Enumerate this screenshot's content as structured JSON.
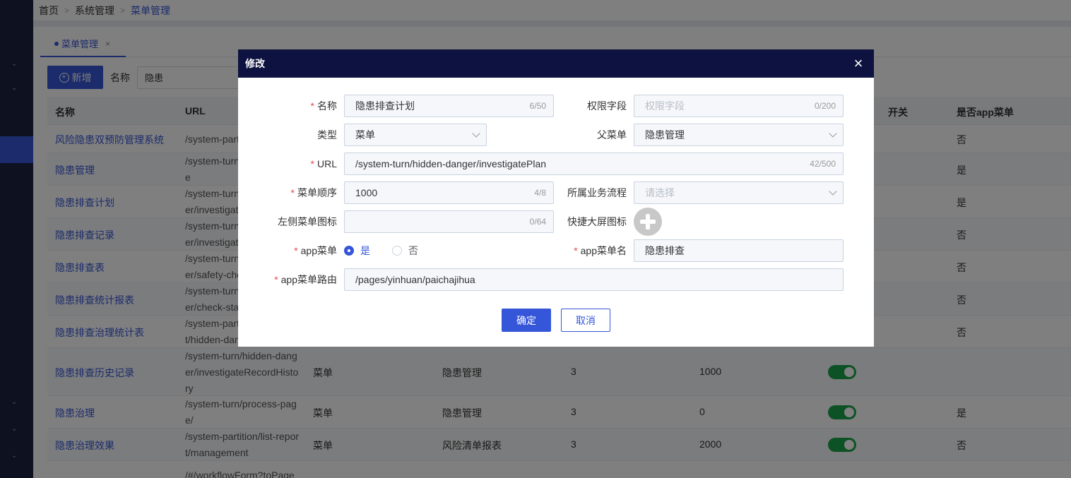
{
  "breadcrumb": {
    "home": "首页",
    "sep": ">",
    "system": "系统管理",
    "current": "菜单管理"
  },
  "tab": {
    "label": "菜单管理",
    "close": "×"
  },
  "toolbar": {
    "add_label": "新增",
    "add_icon": "+",
    "search_label": "名称",
    "search_value": "隐患"
  },
  "table": {
    "headers": {
      "name": "名称",
      "url": "URL",
      "switch": "开关",
      "app": "是否app菜单"
    },
    "rows": [
      {
        "name": "风险隐患双预防管理系统",
        "url": "/system-part",
        "type": "",
        "parent": "",
        "level": "",
        "order": "",
        "app": "否"
      },
      {
        "name": "隐患管理",
        "url": "/system-turn\ne",
        "type": "",
        "parent": "",
        "level": "",
        "order": "",
        "app": "是"
      },
      {
        "name": "隐患排查计划",
        "url": "/system-turn\ner/investigat",
        "type": "",
        "parent": "",
        "level": "",
        "order": "",
        "app": "是"
      },
      {
        "name": "隐患排查记录",
        "url": "/system-turn\ner/investigat",
        "type": "",
        "parent": "",
        "level": "",
        "order": "",
        "app": "否"
      },
      {
        "name": "隐患排查表",
        "url": "/system-turn\ner/safety-che",
        "type": "",
        "parent": "",
        "level": "",
        "order": "",
        "app": "否"
      },
      {
        "name": "隐患排查统计报表",
        "url": "/system-turn\ner/check-sta",
        "type": "",
        "parent": "",
        "level": "",
        "order": "",
        "app": "否"
      },
      {
        "name": "隐患排查治理统计表",
        "url": "/system-part\nt/hidden-dan",
        "type": "",
        "parent": "",
        "level": "",
        "order": "",
        "app": "否"
      },
      {
        "name": "隐患排查历史记录",
        "url": "/system-turn/hidden-dang\ner/investigateRecordHisto\nry",
        "type": "菜单",
        "parent": "隐患管理",
        "level": "3",
        "order": "1000",
        "app": ""
      },
      {
        "name": "隐患治理",
        "url": "/system-turn/process-pag\ne/",
        "type": "菜单",
        "parent": "隐患管理",
        "level": "3",
        "order": "0",
        "app": "是"
      },
      {
        "name": "隐患治理效果",
        "url": "/system-partition/list-repor\nt/management",
        "type": "菜单",
        "parent": "风险清单报表",
        "level": "3",
        "order": "2000",
        "app": "否"
      },
      {
        "name": "",
        "url": "/#/workflowForm?toPage",
        "type": "",
        "parent": "",
        "level": "",
        "order": "",
        "app": ""
      }
    ]
  },
  "dialog": {
    "title": "修改",
    "close": "×",
    "required_mark": "*",
    "name": {
      "label": "名称",
      "value": "隐患排查计划",
      "count": "6/50"
    },
    "perm": {
      "label": "权限字段",
      "placeholder": "权限字段",
      "count": "0/200"
    },
    "type": {
      "label": "类型",
      "value": "菜单"
    },
    "parent": {
      "label": "父菜单",
      "value": "隐患管理"
    },
    "url": {
      "label": "URL",
      "value": "/system-turn/hidden-danger/investigatePlan",
      "count": "42/500"
    },
    "order": {
      "label": "菜单顺序",
      "value": "1000",
      "count": "4/8"
    },
    "flow": {
      "label": "所属业务流程",
      "placeholder": "请选择"
    },
    "left_icon": {
      "label": "左侧菜单图标",
      "count": "0/64"
    },
    "screen_icon": {
      "label": "快捷大屏图标"
    },
    "app_menu": {
      "label": "app菜单",
      "yes": "是",
      "no": "否"
    },
    "app_name": {
      "label": "app菜单名",
      "value": "隐患排查"
    },
    "app_route": {
      "label": "app菜单路由",
      "value": "/pages/yinhuan/paichajihua"
    },
    "ok": "确定",
    "cancel": "取消"
  },
  "colors": {
    "primary": "#3656d9",
    "header": "#0d1240",
    "sidebar": "#1b2340",
    "toggle_on": "#1aa44a"
  }
}
